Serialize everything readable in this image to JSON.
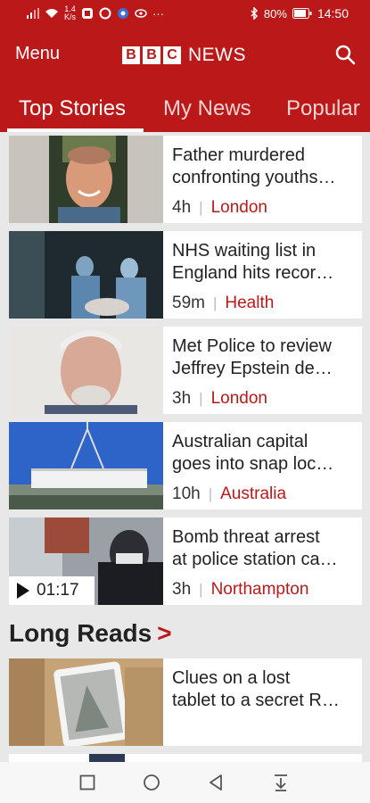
{
  "status_bar": {
    "speed": "1.4",
    "speed_unit": "K/s",
    "more": "···",
    "battery": "80%",
    "time": "14:50"
  },
  "app_bar": {
    "menu_label": "Menu",
    "logo_letters": [
      "B",
      "B",
      "C"
    ],
    "logo_word": "NEWS"
  },
  "tabs": [
    {
      "label": "Top Stories",
      "active": true
    },
    {
      "label": "My News",
      "active": false
    },
    {
      "label": "Popular",
      "active": false
    }
  ],
  "stories": [
    {
      "headline_line1": "Father murdered",
      "headline_line2": "confronting youths…",
      "time": "4h",
      "topic": "London"
    },
    {
      "headline_line1": "NHS waiting list in",
      "headline_line2": "England hits recor…",
      "time": "59m",
      "topic": "Health"
    },
    {
      "headline_line1": "Met Police to review",
      "headline_line2": "Jeffrey Epstein de…",
      "time": "3h",
      "topic": "London"
    },
    {
      "headline_line1": "Australian capital",
      "headline_line2": "goes into snap loc…",
      "time": "10h",
      "topic": "Australia"
    },
    {
      "headline_line1": "Bomb threat arrest",
      "headline_line2": "at police station ca…",
      "time": "3h",
      "topic": "Northampton",
      "video_duration": "01:17"
    }
  ],
  "long_reads": {
    "title": "Long Reads",
    "chevron": ">",
    "items": [
      {
        "headline_line1": "Clues on a lost",
        "headline_line2": "tablet to a secret R…"
      }
    ]
  },
  "colors": {
    "brand_red": "#bb1919"
  }
}
